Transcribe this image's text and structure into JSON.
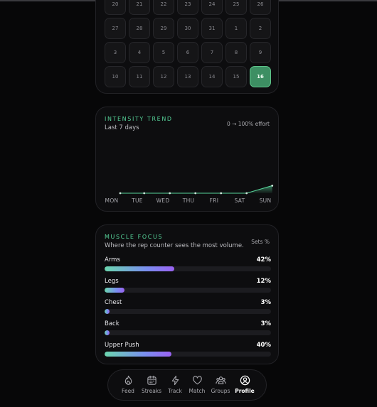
{
  "calendar": {
    "days": [
      "20",
      "21",
      "22",
      "23",
      "24",
      "25",
      "26",
      "27",
      "28",
      "29",
      "30",
      "31",
      "1",
      "2",
      "3",
      "4",
      "5",
      "6",
      "7",
      "8",
      "9",
      "10",
      "11",
      "12",
      "13",
      "14",
      "15",
      "16"
    ],
    "today": "16"
  },
  "trend": {
    "label": "INTENSITY TREND",
    "subtitle": "Last 7 days",
    "range_note": "0 → 100% effort",
    "chart_data": {
      "type": "line",
      "categories": [
        "MON",
        "TUE",
        "WED",
        "THU",
        "FRI",
        "SAT",
        "SUN"
      ],
      "values": [
        0,
        0,
        0,
        0,
        0,
        0,
        20
      ],
      "ylim": [
        0,
        100
      ]
    }
  },
  "muscle": {
    "label": "MUSCLE FOCUS",
    "subtitle": "Where the rep counter sees the most volume.",
    "unit": "Sets %",
    "items": [
      {
        "name": "Arms",
        "percent": 42,
        "percent_label": "42%"
      },
      {
        "name": "Legs",
        "percent": 12,
        "percent_label": "12%"
      },
      {
        "name": "Chest",
        "percent": 3,
        "percent_label": "3%"
      },
      {
        "name": "Back",
        "percent": 3,
        "percent_label": "3%"
      },
      {
        "name": "Upper Push",
        "percent": 40,
        "percent_label": "40%"
      }
    ],
    "bar_gradient": [
      "#6bd6ae",
      "#7a8ff0",
      "#9a62f2"
    ]
  },
  "nav": {
    "items": [
      {
        "label": "Feed",
        "icon": "flame-icon"
      },
      {
        "label": "Streaks",
        "icon": "calendar-icon"
      },
      {
        "label": "Track",
        "icon": "bolt-icon"
      },
      {
        "label": "Match",
        "icon": "heart-icon"
      },
      {
        "label": "Groups",
        "icon": "groups-icon"
      },
      {
        "label": "Profile",
        "icon": "profile-icon"
      }
    ],
    "active": "Profile"
  },
  "colors": {
    "accent": "#57d49a",
    "today_cell": "#3d8f63",
    "background": "#070708",
    "card": "#0d0d0f"
  }
}
